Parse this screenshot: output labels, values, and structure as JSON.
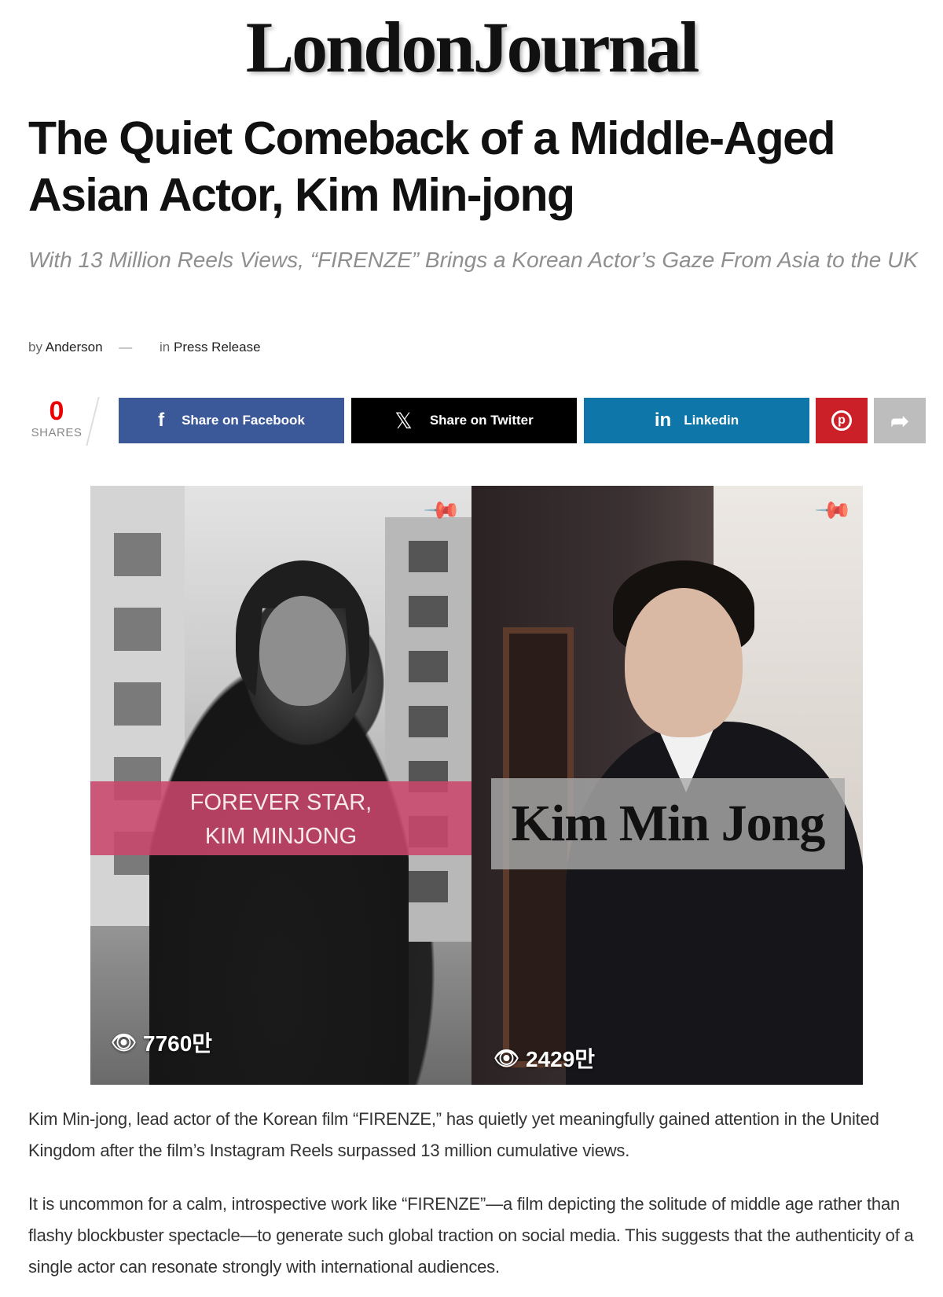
{
  "masthead": {
    "logo_text": "LondonJournal"
  },
  "article": {
    "headline": "The Quiet Comeback of a Middle-Aged Asian Actor, Kim Min-jong",
    "subtitle": "With 13 Million Reels Views, “FIRENZE” Brings a Korean Actor’s Gaze From Asia to the UK",
    "byline": {
      "by_prefix": "by",
      "author": "Anderson",
      "separator": "—",
      "in_prefix": "in",
      "category": "Press Release"
    },
    "paragraphs": [
      "Kim Min-jong, lead actor of the Korean film “FIRENZE,” has quietly yet meaningfully gained attention in the United Kingdom after the film’s Instagram Reels surpassed 13 million cumulative views.",
      "It is uncommon for a calm, introspective work like “FIRENZE”—a film depicting the solitude of middle age rather than flashy blockbuster spectacle—to generate such global traction on social media. This suggests that the authenticity of a single actor can resonate strongly with international audiences."
    ]
  },
  "share_bar": {
    "count": "0",
    "count_label": "SHARES",
    "buttons": {
      "facebook": {
        "label": "Share on Facebook",
        "icon": "facebook-icon",
        "color": "#3b5998"
      },
      "twitter": {
        "label": "Share on Twitter",
        "icon": "x-icon",
        "color": "#000000"
      },
      "linkedin": {
        "label": "Linkedin",
        "icon": "linkedin-icon",
        "color": "#0e76a8"
      },
      "pinterest": {
        "icon": "pinterest-icon",
        "color": "#cb2027"
      },
      "more": {
        "icon": "share-arrow-icon",
        "color": "#bdbdbd"
      }
    }
  },
  "images": {
    "left": {
      "banner_line1": "FOREVER STAR,",
      "banner_line2": "KIM MINJONG",
      "views": "7760만",
      "banner_color": "#c9476c"
    },
    "right": {
      "banner_text": "Kim Min Jong",
      "views": "2429만"
    }
  },
  "colors": {
    "share_count": "#ee0000",
    "subtitle": "#8f8f8f"
  }
}
